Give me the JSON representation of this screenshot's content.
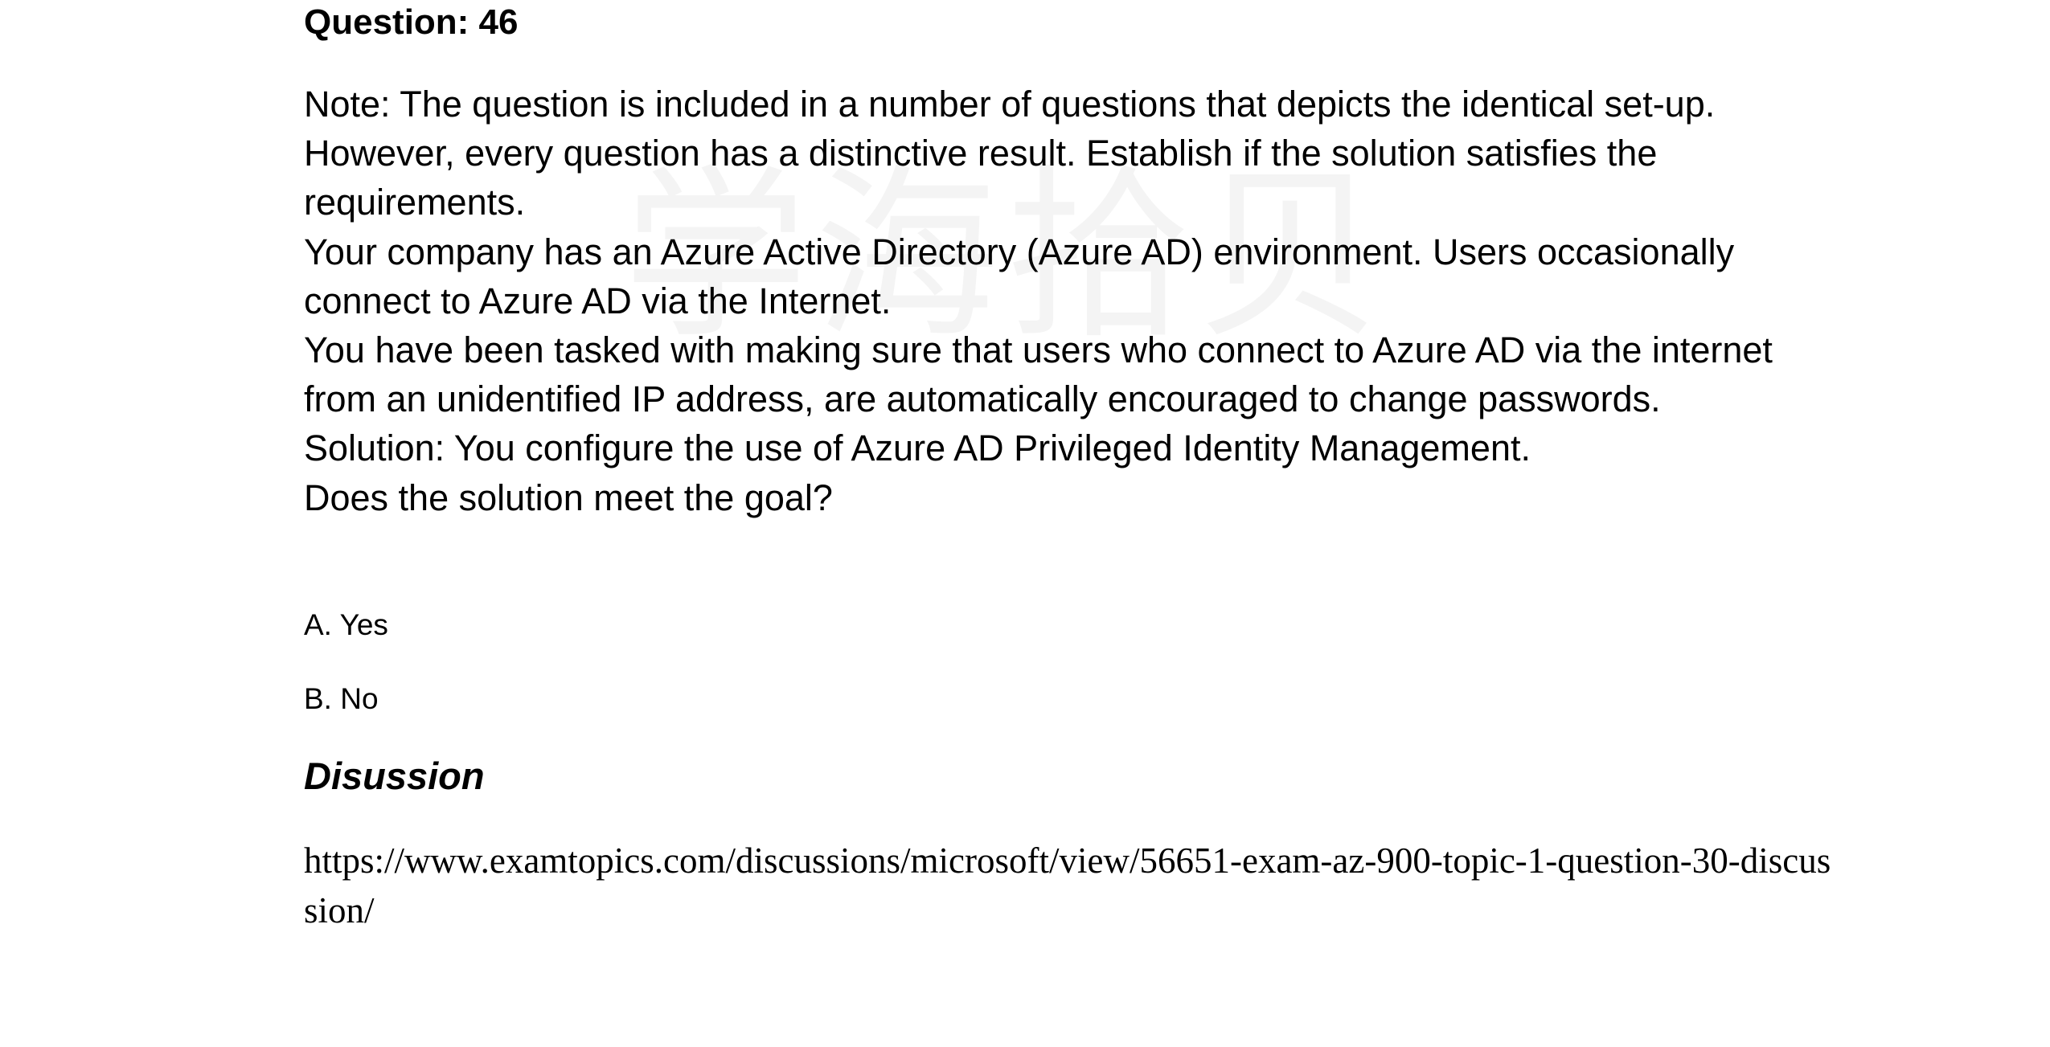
{
  "question": {
    "title": "Question: 46",
    "paragraphs": [
      "Note: The question is included in a number of questions that depicts the identical set-up. However, every question has a distinctive result. Establish if the solution satisfies the requirements.",
      "Your company has an Azure Active Directory (Azure AD) environment. Users occasionally connect to Azure AD via the Internet.",
      "You have been tasked with making sure that users who connect to Azure AD via the internet from an unidentified IP address, are automatically encouraged to change passwords.",
      "Solution: You configure the use of Azure AD Privileged Identity Management.",
      "Does the solution meet the goal?"
    ],
    "options": [
      "A. Yes",
      "B. No"
    ]
  },
  "discussion": {
    "heading": "Disussion",
    "link": "https://www.examtopics.com/discussions/microsoft/view/56651-exam-az-900-topic-1-question-30-discussion/"
  },
  "watermark": {
    "text": "学海拾贝"
  }
}
